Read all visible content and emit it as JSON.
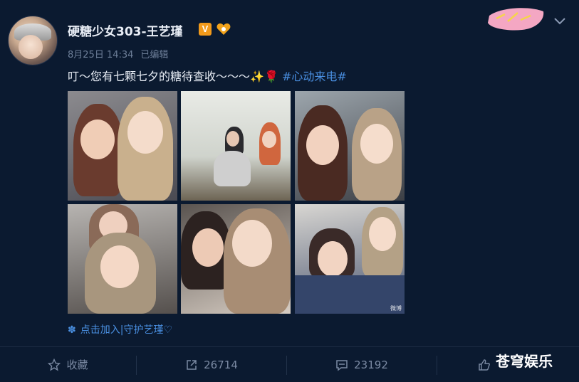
{
  "post": {
    "author": "硬糖少女303-王艺瑾",
    "verified_badge": "V",
    "timestamp": "8月25日 14:34",
    "edited": "已编辑",
    "text": "叮～您有七颗七夕的糖待查收～～～",
    "hashtag": "#心动来电#",
    "fanclub_link": "点击加入|守护艺瑾♡",
    "photo_watermark": "微博"
  },
  "actions": {
    "favorite_label": "收藏",
    "repost_count": "26714",
    "comment_count": "23192"
  },
  "watermark": "苍穹娱乐",
  "colors": {
    "background": "#0b1a30",
    "link": "#4a90e2",
    "verified": "#f29a1b"
  }
}
